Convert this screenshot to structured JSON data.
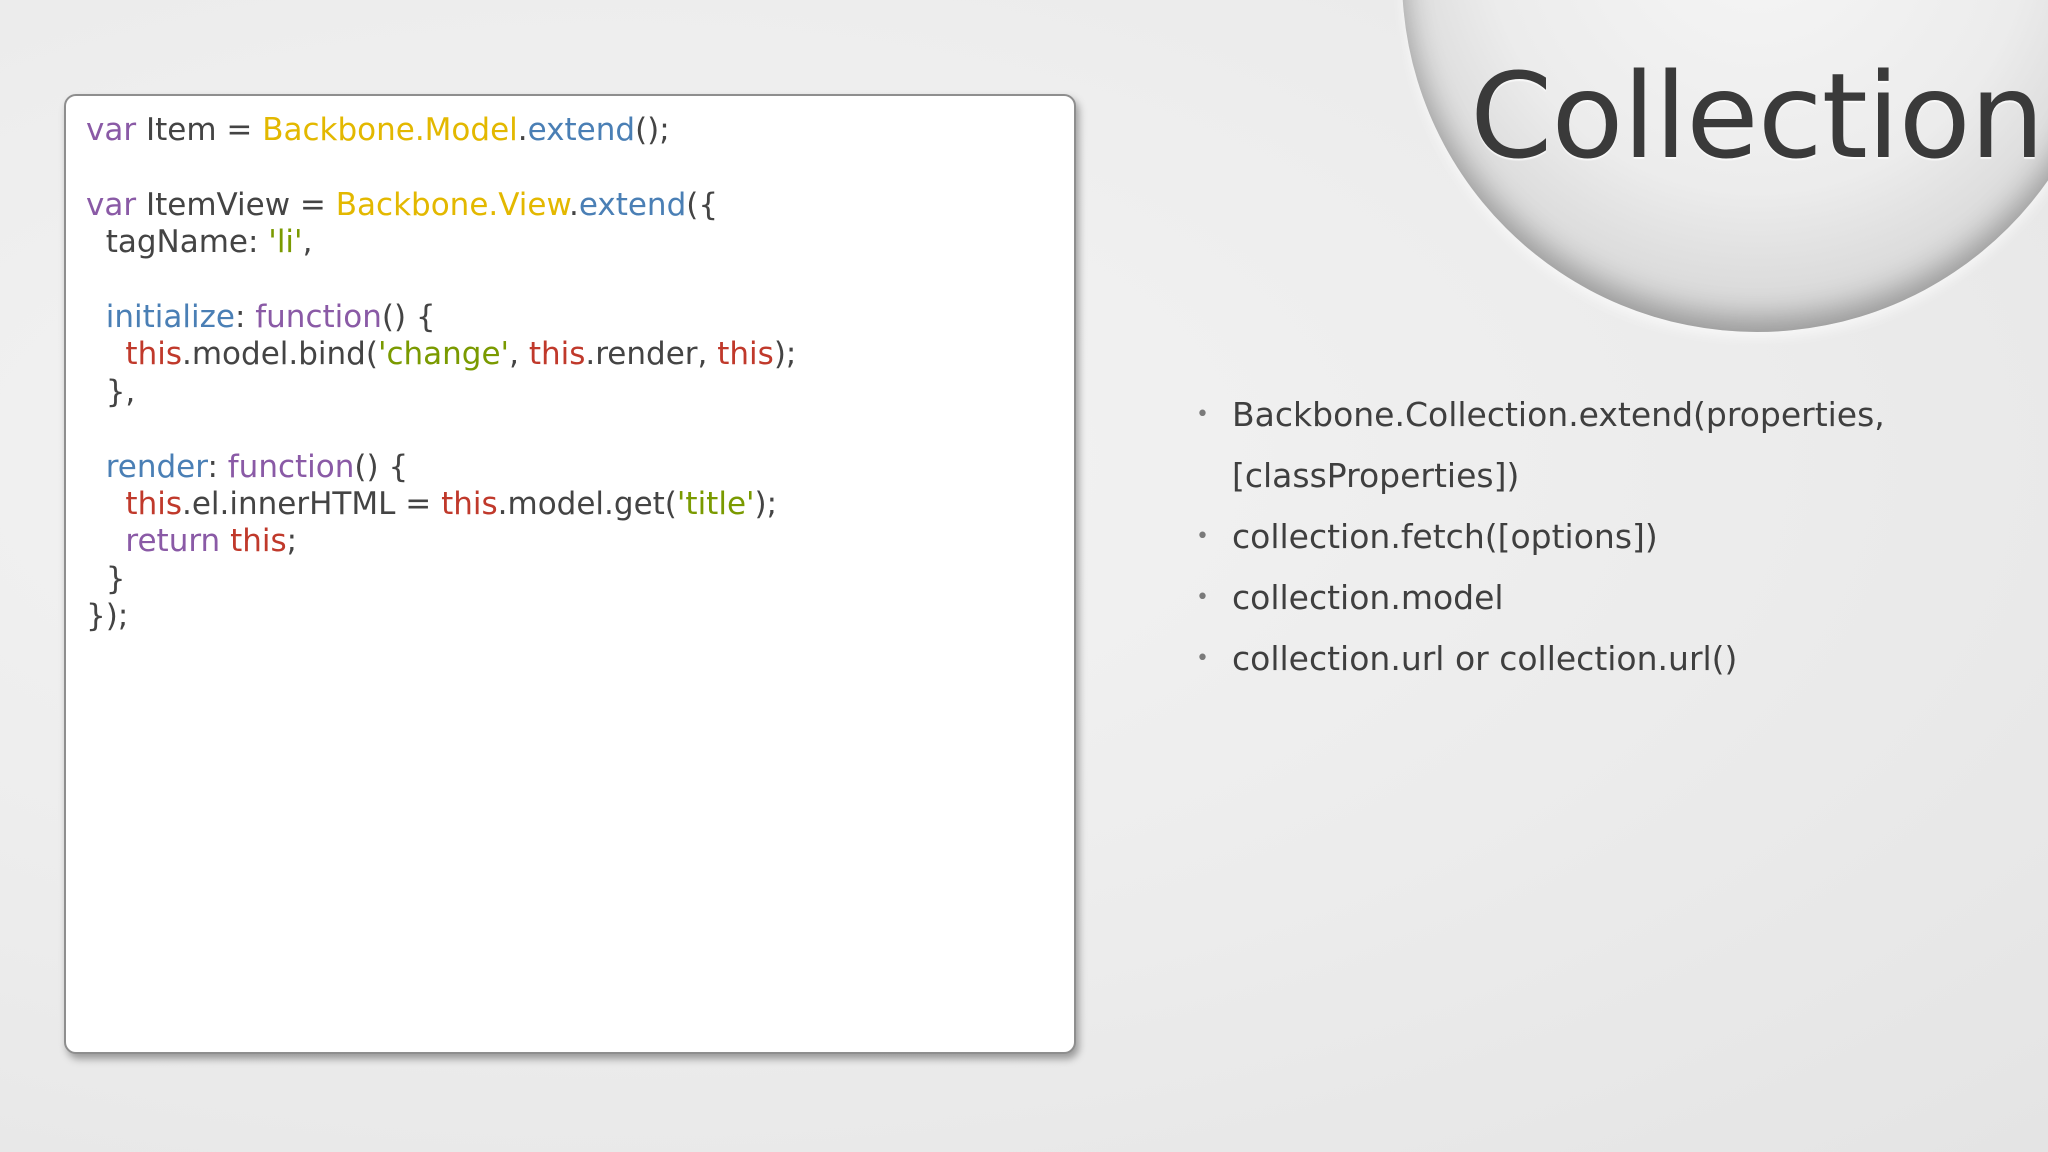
{
  "slide": {
    "title": "Collection",
    "code_lines": [
      [
        {
          "t": "var",
          "c": "kw"
        },
        {
          "t": " Item = ",
          "c": "pl"
        },
        {
          "t": "Backbone.Model",
          "c": "bb"
        },
        {
          "t": ".",
          "c": "pl"
        },
        {
          "t": "extend",
          "c": "fn"
        },
        {
          "t": "();",
          "c": "pl"
        }
      ],
      [],
      [
        {
          "t": "var",
          "c": "kw"
        },
        {
          "t": " ItemView = ",
          "c": "pl"
        },
        {
          "t": "Backbone.View",
          "c": "bb"
        },
        {
          "t": ".",
          "c": "pl"
        },
        {
          "t": "extend",
          "c": "fn"
        },
        {
          "t": "({",
          "c": "pl"
        }
      ],
      [
        {
          "t": "  tagName: ",
          "c": "pl"
        },
        {
          "t": "'li'",
          "c": "str"
        },
        {
          "t": ",",
          "c": "pl"
        }
      ],
      [],
      [
        {
          "t": "  ",
          "c": "pl"
        },
        {
          "t": "initialize",
          "c": "fn"
        },
        {
          "t": ": ",
          "c": "pl"
        },
        {
          "t": "function",
          "c": "kw"
        },
        {
          "t": "() {",
          "c": "pl"
        }
      ],
      [
        {
          "t": "    ",
          "c": "pl"
        },
        {
          "t": "this",
          "c": "th"
        },
        {
          "t": ".model.bind(",
          "c": "pl"
        },
        {
          "t": "'change'",
          "c": "str"
        },
        {
          "t": ", ",
          "c": "pl"
        },
        {
          "t": "this",
          "c": "th"
        },
        {
          "t": ".render, ",
          "c": "pl"
        },
        {
          "t": "this",
          "c": "th"
        },
        {
          "t": ");",
          "c": "pl"
        }
      ],
      [
        {
          "t": "  },",
          "c": "pl"
        }
      ],
      [],
      [
        {
          "t": "  ",
          "c": "pl"
        },
        {
          "t": "render",
          "c": "fn"
        },
        {
          "t": ": ",
          "c": "pl"
        },
        {
          "t": "function",
          "c": "kw"
        },
        {
          "t": "() {",
          "c": "pl"
        }
      ],
      [
        {
          "t": "    ",
          "c": "pl"
        },
        {
          "t": "this",
          "c": "th"
        },
        {
          "t": ".el.innerHTML = ",
          "c": "pl"
        },
        {
          "t": "this",
          "c": "th"
        },
        {
          "t": ".model.get(",
          "c": "pl"
        },
        {
          "t": "'title'",
          "c": "str"
        },
        {
          "t": ");",
          "c": "pl"
        }
      ],
      [
        {
          "t": "    ",
          "c": "pl"
        },
        {
          "t": "return",
          "c": "kw"
        },
        {
          "t": " ",
          "c": "pl"
        },
        {
          "t": "this",
          "c": "th"
        },
        {
          "t": ";",
          "c": "pl"
        }
      ],
      [
        {
          "t": "  }",
          "c": "pl"
        }
      ],
      [
        {
          "t": "});",
          "c": "pl"
        }
      ]
    ],
    "bullets": [
      "Backbone.Collection.extend(properties, [classProperties])",
      "collection.fetch([options])",
      "collection.model",
      "collection.url or collection.url()"
    ],
    "bullet_glyph": "•",
    "colors": {
      "keyword": "#8a5aa6",
      "backbone": "#e3b800",
      "method": "#4a7fb5",
      "string": "#7a9a00",
      "this": "#c0392b",
      "text": "#444444"
    }
  }
}
